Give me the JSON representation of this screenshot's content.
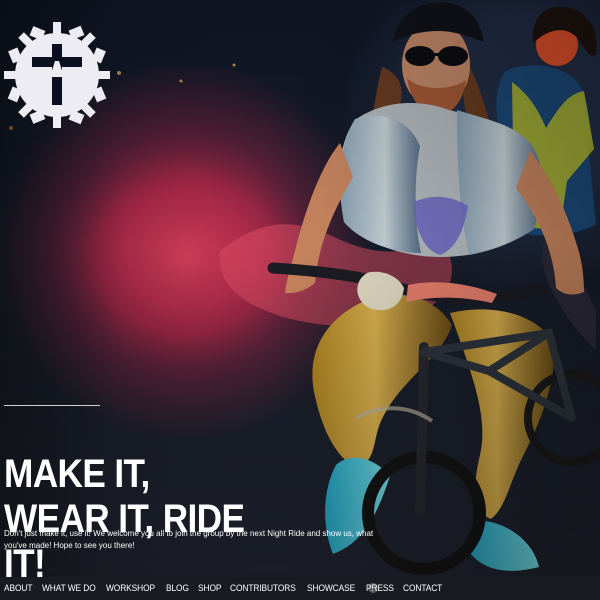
{
  "brand": {
    "logo_icon": "cross-gear-icon",
    "colors": {
      "logo": "#ececf2",
      "logo_mark": "#0b1020",
      "smoke": "#b9284e",
      "nav_bar": "#181b22",
      "text": "#ffffff"
    }
  },
  "hero": {
    "headline_line_1": "MAKE IT,",
    "headline_line_2": "WEAR IT, RIDE IT!",
    "description": "Don't just make it, use it! We welcome you all to join the group by the next Night Ride and show us, what you've made! Hope to see you there!"
  },
  "navigation": {
    "items": [
      {
        "label": "ABOUT"
      },
      {
        "label": "WHAT WE DO"
      },
      {
        "label": "WORKSHOP"
      },
      {
        "label": "BLOG"
      },
      {
        "label": "SHOP"
      },
      {
        "label": "CONTRIBUTORS"
      },
      {
        "label": "SHOWCASE"
      },
      {
        "label": "PRESS"
      },
      {
        "label": "CONTACT"
      }
    ],
    "scroll_indicator_icon": "scroll-down-icon"
  }
}
